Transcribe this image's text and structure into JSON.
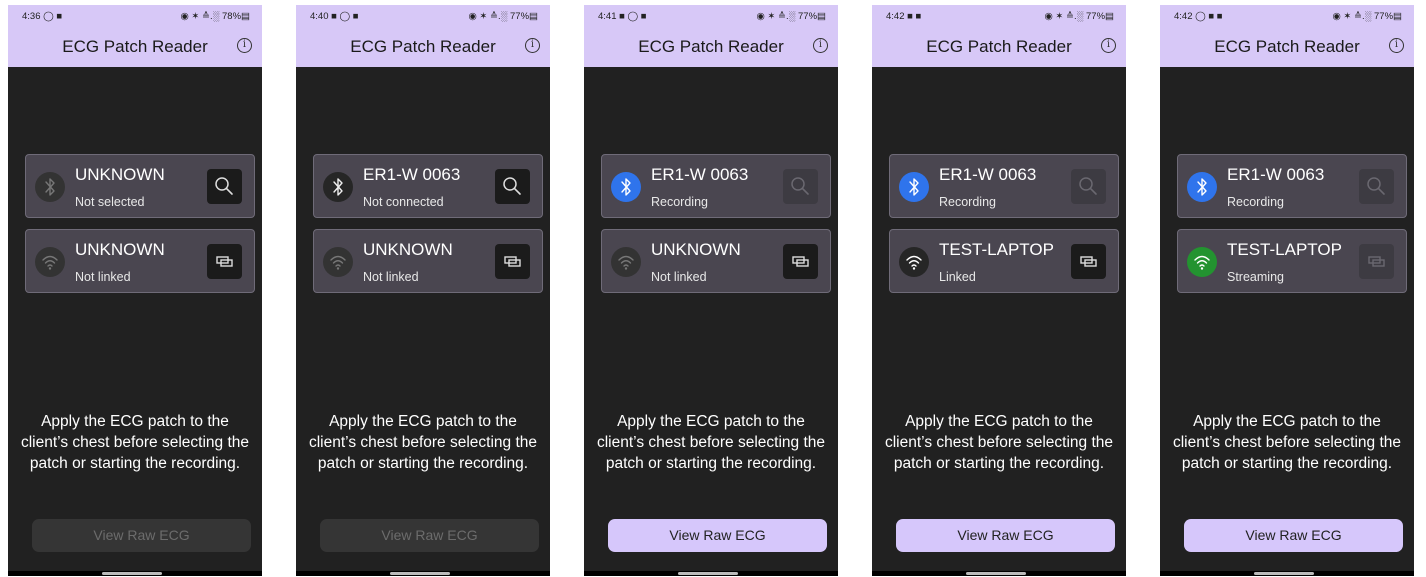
{
  "screens": [
    {
      "status_time": "4:36 ◯ ■",
      "status_right": "◉ ✶ ≙.░ 78%▤",
      "title": "ECG Patch Reader",
      "patch": {
        "name": "UNKNOWN",
        "status": "Not selected",
        "icon_state": "inactive",
        "action_state": "enabled"
      },
      "link": {
        "name": "UNKNOWN",
        "status": "Not linked",
        "icon_state": "inactive",
        "action_state": "enabled"
      },
      "instructions": "Apply the ECG patch to the client’s chest before selecting the patch or starting the recording.",
      "raw_button": {
        "label": "View Raw ECG",
        "state": "disabled"
      }
    },
    {
      "status_time": "4:40 ■ ◯ ■",
      "status_right": "◉ ✶ ≙.░ 77%▤",
      "title": "ECG Patch Reader",
      "patch": {
        "name": "ER1-W 0063",
        "status": "Not connected",
        "icon_state": "dark",
        "action_state": "enabled"
      },
      "link": {
        "name": "UNKNOWN",
        "status": "Not linked",
        "icon_state": "inactive",
        "action_state": "enabled"
      },
      "instructions": "Apply the ECG patch to the client’s chest before selecting the patch or starting the recording.",
      "raw_button": {
        "label": "View Raw ECG",
        "state": "disabled"
      }
    },
    {
      "status_time": "4:41 ■ ◯ ■",
      "status_right": "◉ ✶ ≙.░ 77%▤",
      "title": "ECG Patch Reader",
      "patch": {
        "name": "ER1-W 0063",
        "status": "Recording",
        "icon_state": "blue",
        "action_state": "disabled"
      },
      "link": {
        "name": "UNKNOWN",
        "status": "Not linked",
        "icon_state": "inactive",
        "action_state": "enabled"
      },
      "instructions": "Apply the ECG patch to the client’s chest before selecting the patch or starting the recording.",
      "raw_button": {
        "label": "View Raw ECG",
        "state": "enabled"
      }
    },
    {
      "status_time": "4:42 ■ ■",
      "status_right": "◉ ✶ ≙.░ 77%▤",
      "title": "ECG Patch Reader",
      "patch": {
        "name": "ER1-W 0063",
        "status": "Recording",
        "icon_state": "blue",
        "action_state": "disabled"
      },
      "link": {
        "name": "TEST-LAPTOP",
        "status": "Linked",
        "icon_state": "dark",
        "action_state": "enabled"
      },
      "instructions": "Apply the ECG patch to the client’s chest before selecting the patch or starting the recording.",
      "raw_button": {
        "label": "View Raw ECG",
        "state": "enabled"
      }
    },
    {
      "status_time": "4:42 ◯ ■ ■",
      "status_right": "◉ ✶ ≙.░ 77%▤",
      "title": "ECG Patch Reader",
      "patch": {
        "name": "ER1-W 0063",
        "status": "Recording",
        "icon_state": "blue",
        "action_state": "disabled"
      },
      "link": {
        "name": "TEST-LAPTOP",
        "status": "Streaming",
        "icon_state": "green",
        "action_state": "disabled"
      },
      "instructions": "Apply the ECG patch to the client’s chest before selecting the patch or starting the recording.",
      "raw_button": {
        "label": "View Raw ECG",
        "state": "enabled"
      }
    }
  ],
  "colors": {
    "appbar": "#d7c8f7",
    "background": "#212121",
    "card": "#4a4650",
    "bluetooth_active": "#2f74ec",
    "wifi_active": "#239330",
    "button_enabled": "#d6c7fb",
    "button_disabled": "#353535"
  },
  "icons": {
    "patch": "bluetooth-icon",
    "link": "wifi-icon",
    "patch_action": "search-icon",
    "link_action": "link-icon",
    "info": "info-icon"
  }
}
